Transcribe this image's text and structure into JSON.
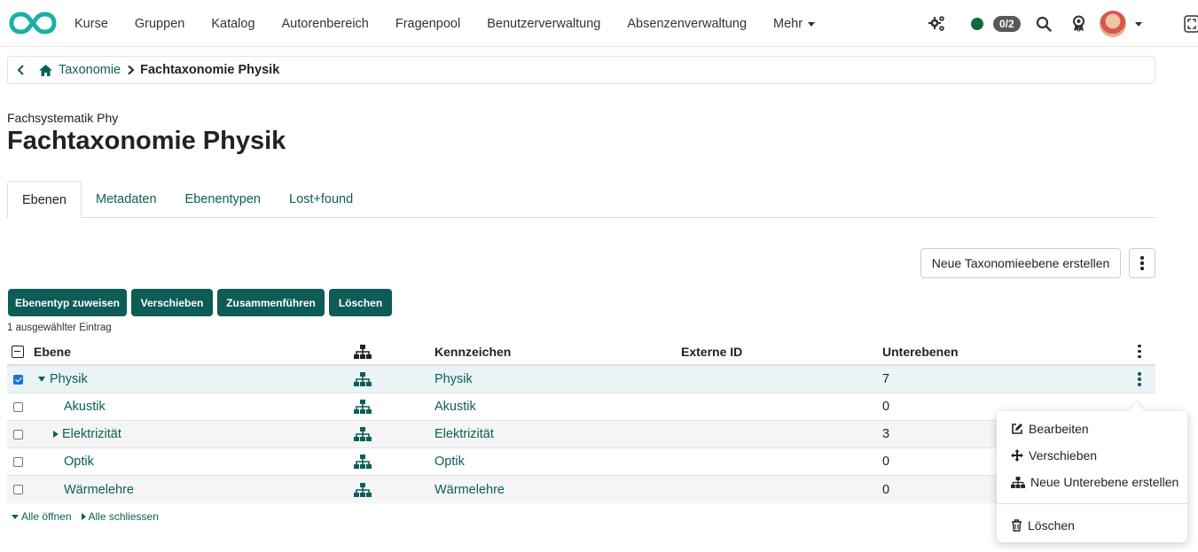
{
  "nav": {
    "items": [
      "Kurse",
      "Gruppen",
      "Katalog",
      "Autorenbereich",
      "Fragenpool",
      "Benutzerverwaltung",
      "Absenzenverwaltung"
    ],
    "more_label": "Mehr",
    "badge": "0/2",
    "status_color": "#0d6b3f",
    "icons": [
      "gears-icon",
      "search-icon",
      "award-icon",
      "avatar",
      "fullscreen-icon"
    ]
  },
  "breadcrumb": {
    "parent": "Taxonomie",
    "current": "Fachtaxonomie Physik"
  },
  "header": {
    "subtitle": "Fachsystematik Phy",
    "title": "Fachtaxonomie Physik"
  },
  "tabs": [
    {
      "label": "Ebenen",
      "active": true
    },
    {
      "label": "Metadaten",
      "active": false
    },
    {
      "label": "Ebenentypen",
      "active": false
    },
    {
      "label": "Lost+found",
      "active": false
    }
  ],
  "actions": {
    "create_label": "Neue Taxonomieebene erstellen",
    "bulk": [
      "Ebenentyp zuweisen",
      "Verschieben",
      "Zusammenführen",
      "Löschen"
    ],
    "selection_info": "1 ausgewählter Eintrag"
  },
  "table": {
    "columns": {
      "level": "Ebene",
      "mark": "Kennzeichen",
      "external_id": "Externe ID",
      "sublevels": "Unterebenen"
    },
    "rows": [
      {
        "name": "Physik",
        "mark": "Physik",
        "external_id": "",
        "sublevels": "7",
        "checked": true,
        "expander": "open",
        "indent": 0
      },
      {
        "name": "Akustik",
        "mark": "Akustik",
        "external_id": "",
        "sublevels": "0",
        "checked": false,
        "expander": "none",
        "indent": 1
      },
      {
        "name": "Elektrizität",
        "mark": "Elektrizität",
        "external_id": "",
        "sublevels": "3",
        "checked": false,
        "expander": "closed",
        "indent": 1
      },
      {
        "name": "Optik",
        "mark": "Optik",
        "external_id": "",
        "sublevels": "0",
        "checked": false,
        "expander": "none",
        "indent": 1
      },
      {
        "name": "Wärmelehre",
        "mark": "Wärmelehre",
        "external_id": "",
        "sublevels": "0",
        "checked": false,
        "expander": "none",
        "indent": 1
      }
    ],
    "open_all": "Alle öffnen",
    "close_all": "Alle schliessen"
  },
  "dropdown": {
    "items": [
      "Bearbeiten",
      "Verschieben",
      "Neue Unterebene erstellen",
      "Löschen"
    ]
  },
  "colors": {
    "brand": "#0d5c56",
    "link": "#0b5f5a",
    "selected_row": "#eaf3f5"
  }
}
